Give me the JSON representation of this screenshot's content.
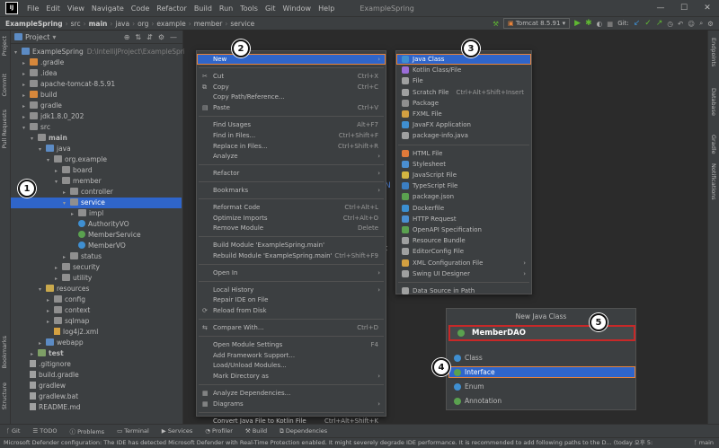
{
  "menubar": {
    "logo": "IJ",
    "items": [
      "File",
      "Edit",
      "View",
      "Navigate",
      "Code",
      "Refactor",
      "Build",
      "Run",
      "Tools",
      "Git",
      "Window",
      "Help"
    ],
    "window_title": "ExampleSpring",
    "controls": [
      "—",
      "☐",
      "✕"
    ]
  },
  "navbar": {
    "crumbs": [
      "ExampleSpring",
      "src",
      "main",
      "java",
      "org",
      "example",
      "member",
      "service"
    ],
    "run_config": "Tomcat 8.5.91",
    "git_label": "Git:"
  },
  "left_strip": [
    "Project",
    "Commit",
    "Pull Requests",
    "Bookmarks",
    "Structure"
  ],
  "right_strip": [
    "Endpoints",
    "Database",
    "Gradle",
    "Notifications"
  ],
  "project": {
    "header": "Project",
    "tree": [
      {
        "label": "ExampleSpring",
        "hint": "D:\\IntelliJProject\\ExampleSpring",
        "depth": 0,
        "arrow": "▾",
        "icon": "folder b"
      },
      {
        "label": ".gradle",
        "depth": 1,
        "arrow": "▸",
        "icon": "folder o"
      },
      {
        "label": ".idea",
        "depth": 1,
        "arrow": "▸",
        "icon": "folder"
      },
      {
        "label": "apache-tomcat-8.5.91",
        "depth": 1,
        "arrow": "▸",
        "icon": "folder"
      },
      {
        "label": "build",
        "depth": 1,
        "arrow": "▸",
        "icon": "folder o"
      },
      {
        "label": "gradle",
        "depth": 1,
        "arrow": "▸",
        "icon": "folder"
      },
      {
        "label": "jdk1.8.0_202",
        "depth": 1,
        "arrow": "▸",
        "icon": "folder"
      },
      {
        "label": "src",
        "depth": 1,
        "arrow": "▾",
        "icon": "folder"
      },
      {
        "label": "main",
        "depth": 2,
        "arrow": "▾",
        "icon": "folder",
        "bold": true
      },
      {
        "label": "java",
        "depth": 3,
        "arrow": "▾",
        "icon": "folder b"
      },
      {
        "label": "org.example",
        "depth": 4,
        "arrow": "▾",
        "icon": "folder"
      },
      {
        "label": "board",
        "depth": 5,
        "arrow": "▸",
        "icon": "folder"
      },
      {
        "label": "member",
        "depth": 5,
        "arrow": "▾",
        "icon": "folder"
      },
      {
        "label": "controller",
        "depth": 6,
        "arrow": "▸",
        "icon": "folder"
      },
      {
        "label": "service",
        "depth": 6,
        "arrow": "▾",
        "icon": "folder",
        "selected": true
      },
      {
        "label": "impl",
        "depth": 7,
        "arrow": "▸",
        "icon": "folder"
      },
      {
        "label": "AuthorityVO",
        "depth": 7,
        "arrow": "",
        "icon": "cls"
      },
      {
        "label": "MemberService",
        "depth": 7,
        "arrow": "",
        "icon": "cls g"
      },
      {
        "label": "MemberVO",
        "depth": 7,
        "arrow": "",
        "icon": "cls"
      },
      {
        "label": "status",
        "depth": 6,
        "arrow": "▸",
        "icon": "folder"
      },
      {
        "label": "security",
        "depth": 5,
        "arrow": "▸",
        "icon": "folder"
      },
      {
        "label": "utility",
        "depth": 5,
        "arrow": "▸",
        "icon": "folder"
      },
      {
        "label": "resources",
        "depth": 3,
        "arrow": "▾",
        "icon": "folder y"
      },
      {
        "label": "config",
        "depth": 4,
        "arrow": "▸",
        "icon": "folder"
      },
      {
        "label": "context",
        "depth": 4,
        "arrow": "▸",
        "icon": "folder"
      },
      {
        "label": "sqlmap",
        "depth": 4,
        "arrow": "▸",
        "icon": "folder"
      },
      {
        "label": "log4j2.xml",
        "depth": 4,
        "arrow": "",
        "icon": "file x"
      },
      {
        "label": "webapp",
        "depth": 3,
        "arrow": "▸",
        "icon": "folder b"
      },
      {
        "label": "test",
        "depth": 2,
        "arrow": "▸",
        "icon": "folder g",
        "bold": true
      },
      {
        "label": ".gitignore",
        "depth": 1,
        "arrow": "",
        "icon": "file"
      },
      {
        "label": "build.gradle",
        "depth": 1,
        "arrow": "",
        "icon": "file"
      },
      {
        "label": "gradlew",
        "depth": 1,
        "arrow": "",
        "icon": "file"
      },
      {
        "label": "gradlew.bat",
        "depth": 1,
        "arrow": "",
        "icon": "file"
      },
      {
        "label": "README.md",
        "depth": 1,
        "arrow": "",
        "icon": "file"
      }
    ]
  },
  "context_menu": [
    {
      "label": "New",
      "sub": true,
      "hl": true
    },
    {
      "sep": true
    },
    {
      "label": "Cut",
      "sc": "Ctrl+X",
      "icon": "✂"
    },
    {
      "label": "Copy",
      "sc": "Ctrl+C",
      "icon": "⧉"
    },
    {
      "label": "Copy Path/Reference..."
    },
    {
      "label": "Paste",
      "sc": "Ctrl+V",
      "icon": "▤"
    },
    {
      "sep": true
    },
    {
      "label": "Find Usages",
      "sc": "Alt+F7"
    },
    {
      "label": "Find in Files...",
      "sc": "Ctrl+Shift+F"
    },
    {
      "label": "Replace in Files...",
      "sc": "Ctrl+Shift+R"
    },
    {
      "label": "Analyze",
      "sub": true
    },
    {
      "sep": true
    },
    {
      "label": "Refactor",
      "sub": true
    },
    {
      "sep": true
    },
    {
      "label": "Bookmarks",
      "sub": true
    },
    {
      "sep": true
    },
    {
      "label": "Reformat Code",
      "sc": "Ctrl+Alt+L"
    },
    {
      "label": "Optimize Imports",
      "sc": "Ctrl+Alt+O"
    },
    {
      "label": "Remove Module",
      "sc": "Delete"
    },
    {
      "sep": true
    },
    {
      "label": "Build Module 'ExampleSpring.main'"
    },
    {
      "label": "Rebuild Module 'ExampleSpring.main'",
      "sc": "Ctrl+Shift+F9"
    },
    {
      "sep": true
    },
    {
      "label": "Open In",
      "sub": true
    },
    {
      "sep": true
    },
    {
      "label": "Local History",
      "sub": true
    },
    {
      "label": "Repair IDE on File"
    },
    {
      "label": "Reload from Disk",
      "icon": "⟳"
    },
    {
      "sep": true
    },
    {
      "label": "Compare With...",
      "sc": "Ctrl+D",
      "icon": "⇆"
    },
    {
      "sep": true
    },
    {
      "label": "Open Module Settings",
      "sc": "F4"
    },
    {
      "label": "Add Framework Support..."
    },
    {
      "label": "Load/Unload Modules..."
    },
    {
      "label": "Mark Directory as",
      "sub": true
    },
    {
      "sep": true
    },
    {
      "label": "Analyze Dependencies...",
      "icon": "▦"
    },
    {
      "label": "Diagrams",
      "sub": true,
      "icon": "▦"
    },
    {
      "sep": true
    },
    {
      "label": "Convert Java File to Kotlin File",
      "sc": "Ctrl+Alt+Shift+K"
    }
  ],
  "new_menu": [
    {
      "label": "Java Class",
      "hl": true,
      "color": "#3f8fd1"
    },
    {
      "label": "Kotlin Class/File",
      "color": "#9a6cd8"
    },
    {
      "label": "File",
      "color": "#9fa0a0"
    },
    {
      "label": "Scratch File",
      "sc": "Ctrl+Alt+Shift+Insert",
      "color": "#9fa0a0"
    },
    {
      "label": "Package",
      "color": "#8f8f8f"
    },
    {
      "label": "FXML File",
      "color": "#d3a041"
    },
    {
      "label": "JavaFX Application",
      "color": "#3f8fd1"
    },
    {
      "label": "package-info.java",
      "color": "#9fa0a0"
    },
    {
      "sep": true
    },
    {
      "label": "HTML File",
      "color": "#e07a3a"
    },
    {
      "label": "Stylesheet",
      "color": "#4a8fd1"
    },
    {
      "label": "JavaScript File",
      "color": "#d3b541"
    },
    {
      "label": "TypeScript File",
      "color": "#3b7fc4"
    },
    {
      "label": "package.json",
      "color": "#5aa14f"
    },
    {
      "label": "Dockerfile",
      "color": "#3b8fd1"
    },
    {
      "label": "HTTP Request",
      "color": "#4a8fd1"
    },
    {
      "label": "OpenAPI Specification",
      "color": "#5aa14f"
    },
    {
      "label": "Resource Bundle",
      "color": "#9fa0a0"
    },
    {
      "label": "EditorConfig File",
      "color": "#9fa0a0"
    },
    {
      "label": "XML Configuration File",
      "sub": true,
      "color": "#d3a041"
    },
    {
      "label": "Swing UI Designer",
      "sub": true,
      "color": "#9fa0a0"
    },
    {
      "sep": true
    },
    {
      "label": "Data Source in Path",
      "color": "#9fa0a0"
    }
  ],
  "dialog": {
    "title": "New Java Class",
    "input_value": "MemberDAO",
    "options": [
      {
        "label": "Class",
        "color": "#3f8fd1"
      },
      {
        "label": "Interface",
        "color": "#5aa14f",
        "selected": true
      },
      {
        "label": "Enum",
        "color": "#3f8fd1"
      },
      {
        "label": "Annotation",
        "color": "#5aa14f"
      }
    ]
  },
  "badges": [
    "1",
    "2",
    "3",
    "4",
    "5"
  ],
  "editor_fragments": [
    "oub",
    "N",
    "n t"
  ],
  "bottom_tabs": [
    "Git",
    "TODO",
    "Problems",
    "Terminal",
    "Services",
    "Profiler",
    "Build",
    "Dependencies"
  ],
  "status": {
    "message": "Microsoft Defender configuration: The IDE has detected Microsoft Defender with Real-Time Protection enabled. It might severely degrade IDE performance. It is recommended to add following paths to the D... (today 오후 5:",
    "branch": "main"
  },
  "colors": {
    "selection": "#2f65ca",
    "highlight_border": "#e8833a",
    "input_border": "#c82828"
  }
}
